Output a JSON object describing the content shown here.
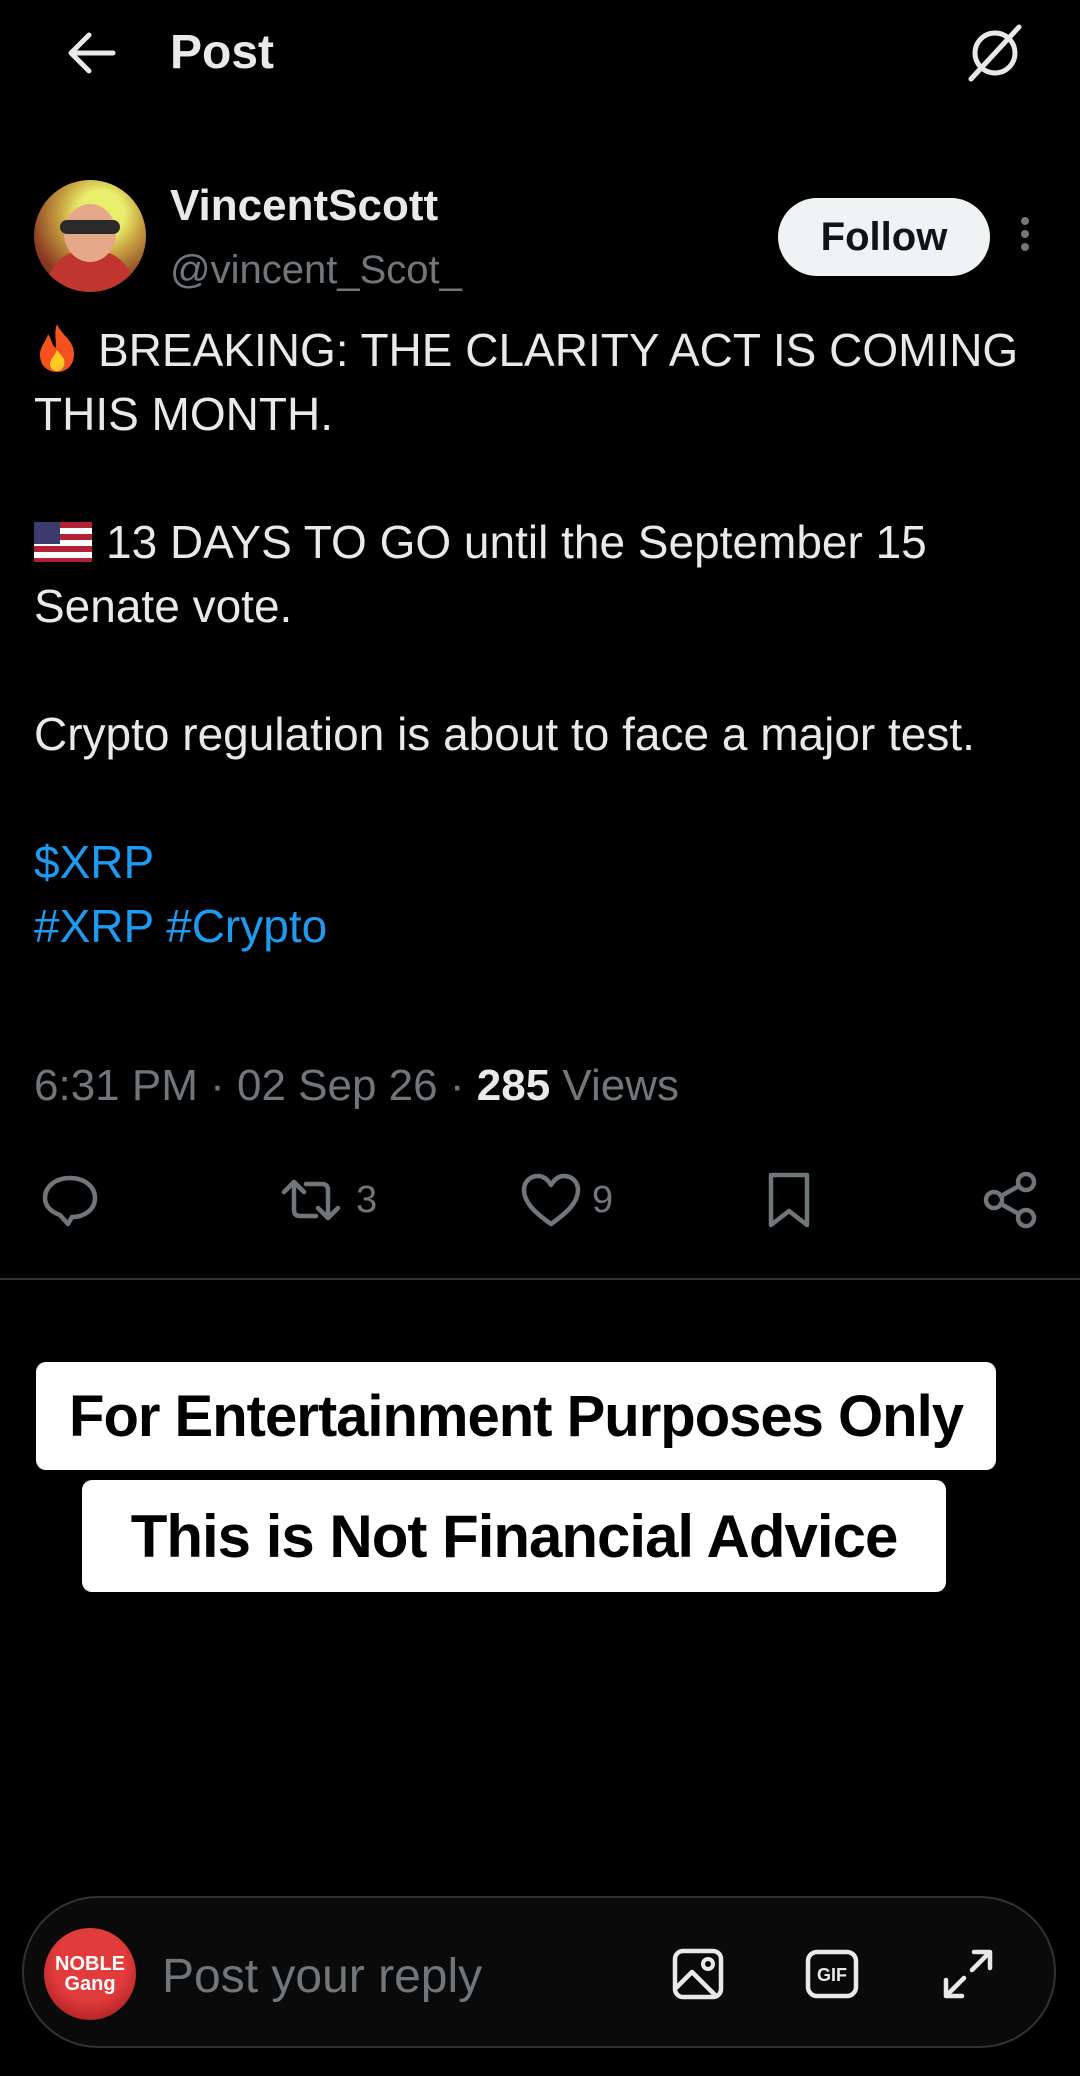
{
  "header": {
    "title": "Post",
    "back_icon": "arrow-left-icon",
    "grok_icon": "grok-icon"
  },
  "author": {
    "name": "VincentScott",
    "handle": "@vincent_Scot_",
    "follow_label": "Follow",
    "more_icon": "more-vertical-icon"
  },
  "post": {
    "line1": "BREAKING: THE CLARITY ACT IS COMING THIS MONTH.",
    "line2": "13 DAYS TO GO until the September 15 Senate vote.",
    "line3": "Crypto regulation is about to face a major test.",
    "cashtag": "$XRP",
    "hashtag1": "#XRP",
    "hashtag2": "#Crypto",
    "emoji1": "fire-emoji",
    "emoji2": "us-flag-emoji"
  },
  "meta": {
    "time": "6:31 PM",
    "date": "02 Sep 26",
    "views_count": "285",
    "views_label": "Views",
    "separator": "·"
  },
  "actions": {
    "reply_icon": "comment-icon",
    "repost_icon": "repost-icon",
    "repost_count": "3",
    "like_icon": "heart-icon",
    "like_count": "9",
    "bookmark_icon": "bookmark-icon",
    "share_icon": "share-icon"
  },
  "disclaimer": {
    "line1": "For Entertainment Purposes Only",
    "line2": "This is Not Financial Advice"
  },
  "reply_bar": {
    "placeholder": "Post your reply",
    "avatar_text": "NOBLE Gang",
    "image_icon": "image-icon",
    "gif_icon": "gif-icon",
    "expand_icon": "expand-icon"
  },
  "colors": {
    "background": "#000000",
    "text": "#e7e9ea",
    "secondary": "#71767b",
    "link": "#1d9bf0"
  }
}
